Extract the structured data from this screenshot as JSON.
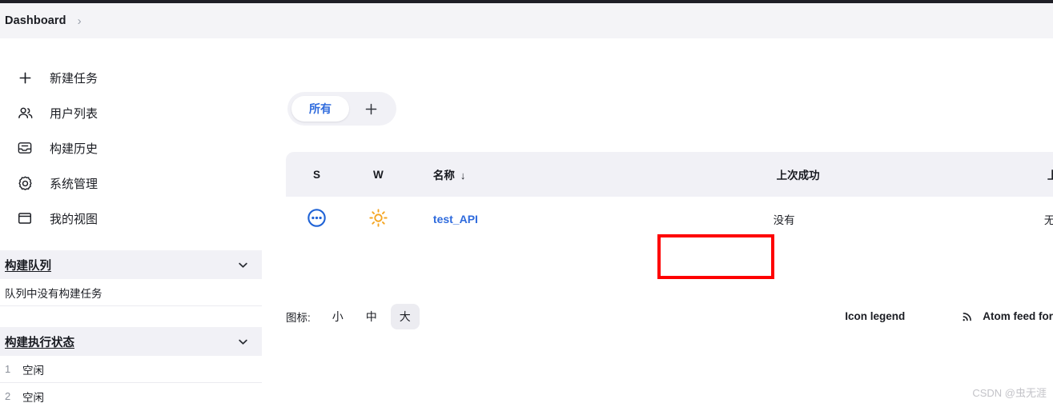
{
  "breadcrumb": {
    "items": [
      "Dashboard"
    ],
    "separator": "›"
  },
  "sidebar": {
    "items": [
      {
        "label": "新建任务",
        "icon": "plus-icon"
      },
      {
        "label": "用户列表",
        "icon": "people-icon"
      },
      {
        "label": "构建历史",
        "icon": "inbox-icon"
      },
      {
        "label": "系统管理",
        "icon": "gear-icon"
      },
      {
        "label": "我的视图",
        "icon": "window-icon"
      }
    ],
    "build_queue": {
      "title": "构建队列",
      "empty_text": "队列中没有构建任务"
    },
    "build_executor": {
      "title": "构建执行状态",
      "executors": [
        {
          "num": "1",
          "state": "空闲"
        },
        {
          "num": "2",
          "state": "空闲"
        }
      ]
    }
  },
  "main": {
    "tabs": {
      "active": "所有",
      "add_label": "+"
    },
    "table": {
      "headers": {
        "s": "S",
        "w": "W",
        "name": "名称",
        "sort_arrow": "↓",
        "last_success": "上次成功",
        "last_failure": "上次失败"
      },
      "rows": [
        {
          "status_icon": "pending-dots-icon",
          "weather_icon": "sunny-icon",
          "name": "test_API",
          "last_success": "没有",
          "last_failure": "无"
        }
      ]
    },
    "icon_size": {
      "label": "图标:",
      "options": [
        "小",
        "中",
        "大"
      ],
      "selected": "大"
    },
    "footer": {
      "icon_legend": "Icon legend",
      "atom_feed": "Atom feed for"
    }
  },
  "watermark": "CSDN @虫无涯",
  "colors": {
    "accent_blue": "#2f6bdd",
    "sunny_yellow": "#f5a623",
    "annotation_red": "#fe0000",
    "panel_gray": "#f1f1f6"
  }
}
